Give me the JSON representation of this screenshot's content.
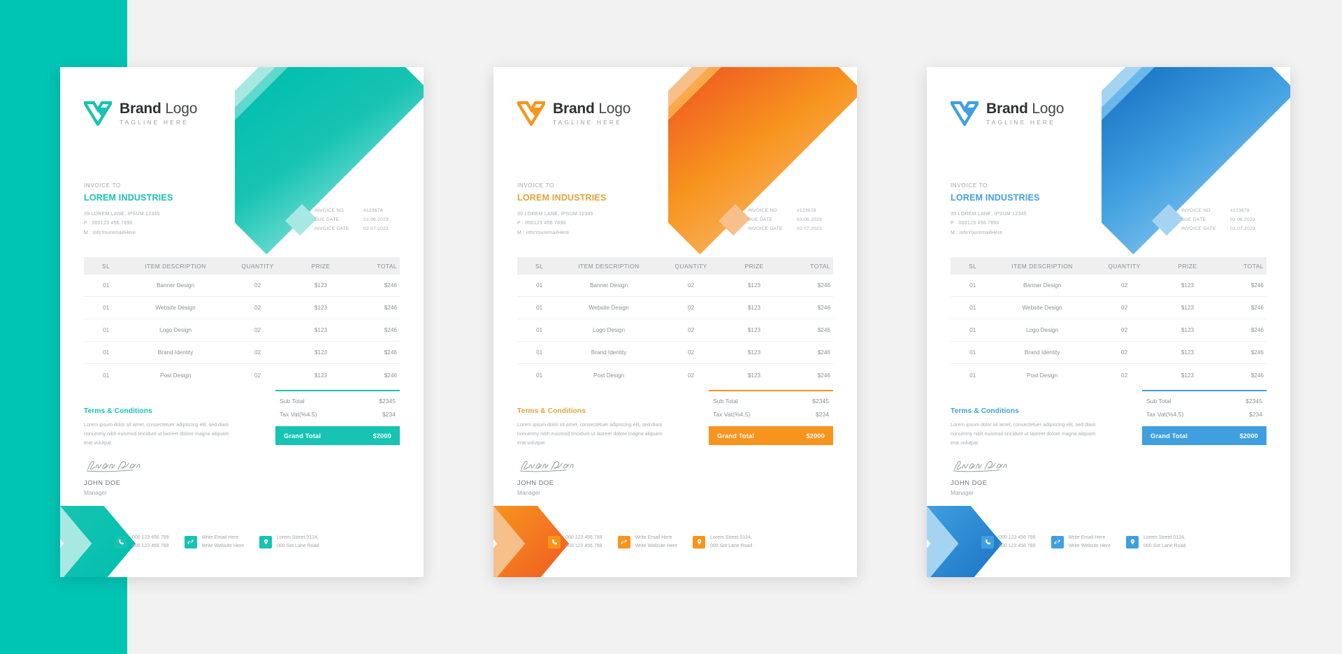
{
  "canvas": {
    "background": "#f2f2f2",
    "accent_panel_color": "#00c4b4"
  },
  "brand": {
    "title_bold": "Brand",
    "title_light": "Logo",
    "tagline": "TAGLINE HERE"
  },
  "bill_to": {
    "label": "INVOICE TO",
    "company": "LOREM INDUSTRIES",
    "address": "39 LOREM LANE, IPSUM 12345",
    "phone": "P : 000123 456 7890",
    "email": "M : infoYouremailHere"
  },
  "meta": {
    "rows": [
      {
        "key": "INVOICE NO",
        "value": "#123678"
      },
      {
        "key": "DUE DATE",
        "value": "02.06.2023"
      },
      {
        "key": "INVOICE DATE",
        "value": "02.07.2023"
      }
    ]
  },
  "table": {
    "headers": [
      "SL",
      "ITEM DESCRIPTION",
      "QUANTITY",
      "PRIZE",
      "TOTAL"
    ],
    "rows": [
      {
        "sl": "01",
        "desc": "Banner Design",
        "qty": "02",
        "prize": "$123",
        "total": "$246"
      },
      {
        "sl": "01",
        "desc": "Website Design",
        "qty": "02",
        "prize": "$123",
        "total": "$246"
      },
      {
        "sl": "01",
        "desc": "Logo Design",
        "qty": "02",
        "prize": "$123",
        "total": "$246"
      },
      {
        "sl": "01",
        "desc": "Brand Identity",
        "qty": "02",
        "prize": "$123",
        "total": "$246"
      },
      {
        "sl": "01",
        "desc": "Post Design",
        "qty": "02",
        "prize": "$123",
        "total": "$246"
      }
    ]
  },
  "totals": {
    "sub_label": "Sub Total",
    "sub_value": "$2345",
    "tax_label": "Tax Vat(%4.5)",
    "tax_value": "$234",
    "grand_label": "Grand Total",
    "grand_value": "$2000"
  },
  "terms": {
    "heading": "Terms & Conditions",
    "body": "Lorem ipsum dolor sit amet, consectetuer adipiscing elit, sed diam nonummy nibh euismod tincidunt ut laoreet dolore magna aliquam erat volutpat."
  },
  "signature": {
    "script": "John Doe",
    "name": "JOHN DOE",
    "role": "Manager"
  },
  "footer": {
    "items": [
      {
        "icon": "phone-icon",
        "line1": "000 123 456 789",
        "line2": "000 123 456 789"
      },
      {
        "icon": "link-icon",
        "line1": "Write Email Here",
        "line2": "Write Website Here"
      },
      {
        "icon": "location-pin-icon",
        "line1": "Lorem Street 0124,",
        "line2": "000 Sot Lane Road"
      }
    ]
  },
  "variants": [
    {
      "id": "teal",
      "accent": "#17c3b2",
      "accent_deep": "#00bfae",
      "accent_mid": "#5fd8cd",
      "accent_pale": "#a8e8e2",
      "logo": "#17c3b2",
      "company_color": "#17c3b2",
      "terms_color": "#17c3b2",
      "rule_color": "#17c3b2",
      "grand_bg": "#17c3b2",
      "icon_bg": "#17c3b2"
    },
    {
      "id": "orange",
      "accent": "#f7941e",
      "accent_deep": "#f05a22",
      "accent_mid": "#f9a94c",
      "accent_pale": "#f7c08a",
      "logo": "#f7941e",
      "company_color": "#e2a33c",
      "terms_color": "#e2a33c",
      "rule_color": "#f7941e",
      "grand_bg": "#f7941e",
      "icon_bg": "#f7941e"
    },
    {
      "id": "blue",
      "accent": "#3f9fe0",
      "accent_deep": "#1a73c4",
      "accent_mid": "#6ab7ea",
      "accent_pale": "#a5d4f2",
      "logo": "#3f9fe0",
      "company_color": "#3f9fe0",
      "terms_color": "#3f9fe0",
      "rule_color": "#3f9fe0",
      "grand_bg": "#3f9fe0",
      "icon_bg": "#3f9fe0"
    }
  ]
}
